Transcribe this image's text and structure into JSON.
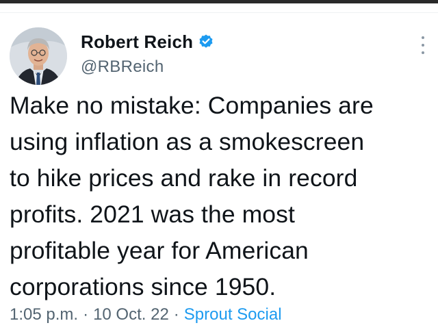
{
  "author": {
    "display_name": "Robert Reich",
    "handle": "@RBReich",
    "verified": true,
    "avatar_icon": "avatar-photo"
  },
  "tweet": {
    "text": "Make no mistake: Companies are\nusing inflation as a smokescreen\nto hike prices and rake in record\nprofits. 2021 was the most\nprofitable year for American\ncorporations since 1950."
  },
  "meta": {
    "time": "1:05 p.m.",
    "separator": "·",
    "date": "10 Oct. 22",
    "source": "Sprout Social"
  },
  "icons": {
    "verified": "verified-badge-icon",
    "more": "more-options-icon"
  },
  "colors": {
    "verified_blue": "#1d9bf0",
    "link_blue": "#1d9bf0",
    "secondary_text": "#536471",
    "primary_text": "#0f1419"
  }
}
